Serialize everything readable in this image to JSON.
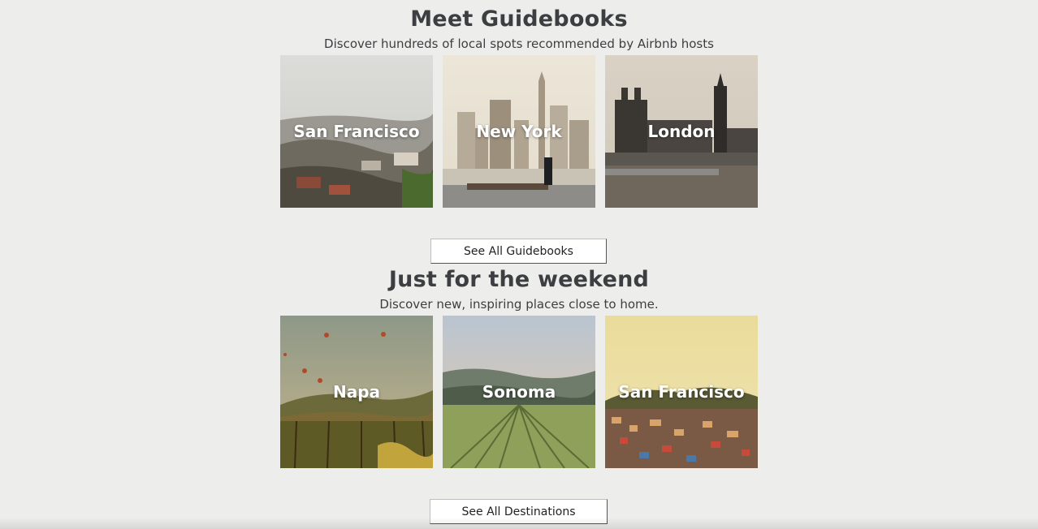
{
  "guidebooks": {
    "title": "Meet Guidebooks",
    "subtitle": "Discover hundreds of local spots recommended by Airbnb hosts",
    "cards": [
      {
        "label": "San Francisco"
      },
      {
        "label": "New York"
      },
      {
        "label": "London"
      }
    ],
    "button_label": "See All Guidebooks"
  },
  "weekend": {
    "title": "Just for the weekend",
    "subtitle": "Discover new, inspiring places close to home.",
    "cards": [
      {
        "label": "Napa"
      },
      {
        "label": "Sonoma"
      },
      {
        "label": "San Francisco"
      }
    ],
    "button_label": "See All Destinations"
  }
}
